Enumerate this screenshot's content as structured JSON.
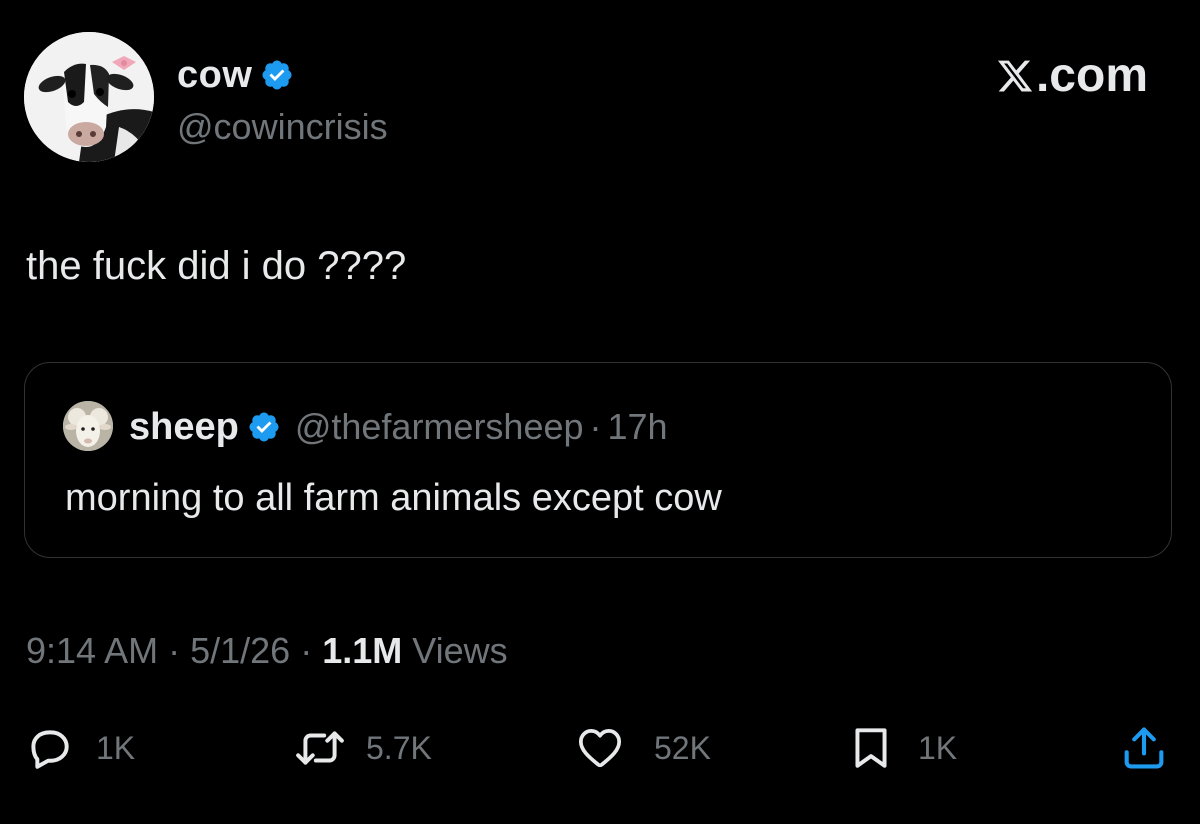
{
  "author": {
    "display_name": "cow",
    "handle": "@cowincrisis",
    "verified": true
  },
  "brand": {
    "label": ".com"
  },
  "tweet": {
    "text": "the fuck did i do ????"
  },
  "quoted": {
    "display_name": "sheep",
    "handle": "@thefarmersheep",
    "separator": "·",
    "time": "17h",
    "text": "morning to all farm animals except cow"
  },
  "meta": {
    "time": "9:14 AM",
    "sep1": " · ",
    "date": "5/1/26",
    "sep2": " · ",
    "views_count": "1.1M",
    "views_label": " Views"
  },
  "actions": {
    "replies": "1K",
    "reposts": "5.7K",
    "likes": "52K",
    "bookmarks": "1K"
  },
  "colors": {
    "background": "#000000",
    "primary_text": "#e7e9ea",
    "secondary_text": "#71767b",
    "verified_blue": "#1d9bf0",
    "border": "#2f3336"
  },
  "icons": {
    "verified": "verified-badge-icon",
    "brand": "x-logo-icon",
    "reply": "reply-bubble-icon",
    "repost": "repost-icon",
    "like": "heart-icon",
    "bookmark": "bookmark-icon",
    "share": "share-icon"
  }
}
